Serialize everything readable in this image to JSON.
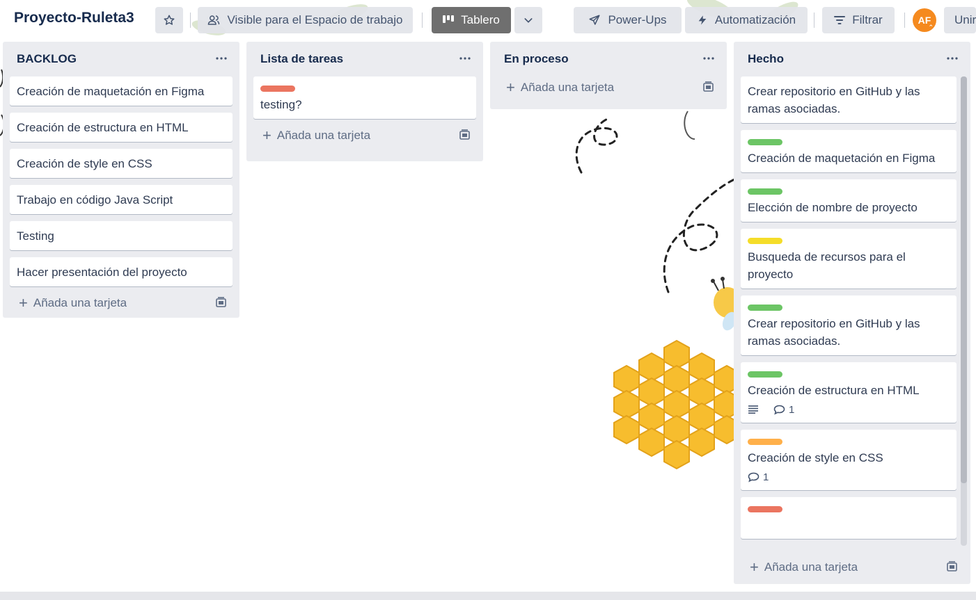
{
  "board": {
    "title": "Proyecto-Ruleta3",
    "visibility_label": "Visible para el Espacio de trabajo",
    "view_label": "Tablero",
    "powerups_label": "Power-Ups",
    "automation_label": "Automatización",
    "filter_label": "Filtrar",
    "avatar_initials": "AF",
    "join_label": "Unir"
  },
  "lists": [
    {
      "title": "BACKLOG",
      "cards": [
        {
          "title": "Creación de maquetación en Figma"
        },
        {
          "title": "Creación de estructura en HTML"
        },
        {
          "title": "Creación de style en CSS"
        },
        {
          "title": "Trabajo en código Java Script"
        },
        {
          "title": "Testing"
        },
        {
          "title": "Hacer presentación del proyecto"
        }
      ],
      "add_label": "Añada una tarjeta"
    },
    {
      "title": "Lista de tareas",
      "cards": [
        {
          "title": "testing?",
          "label_color": "#eb7560"
        }
      ],
      "add_label": "Añada una tarjeta"
    },
    {
      "title": "En proceso",
      "cards": [],
      "add_label": "Añada una tarjeta"
    },
    {
      "title": "Hecho",
      "cards": [
        {
          "title": "Crear repositorio en GitHub y las ramas asociadas."
        },
        {
          "title": "Creación de maquetación en Figma",
          "label_color": "#6cc565"
        },
        {
          "title": "Elección de nombre de proyecto",
          "label_color": "#6cc565"
        },
        {
          "title": "Busqueda de recursos para el proyecto",
          "label_color": "#f5dd29"
        },
        {
          "title": "Crear repositorio en GitHub y las ramas asociadas.",
          "label_color": "#6cc565"
        },
        {
          "title": "Creación de estructura en HTML",
          "label_color": "#6cc565",
          "comments": "1",
          "has_description": true
        },
        {
          "title": "Creación de style en CSS",
          "label_color": "#ffb04a",
          "comments": "1"
        },
        {
          "title": "",
          "label_color": "#eb7560"
        }
      ],
      "add_label": "Añada una tarjeta"
    }
  ],
  "icons": {
    "star": "star-icon",
    "visibility": "people-icon",
    "board": "board-icon",
    "chevron": "chevron-down-icon",
    "rocket": "rocket-icon",
    "bolt": "lightning-icon",
    "filter": "filter-icon",
    "more": "more-icon",
    "template": "template-icon",
    "description": "description-icon",
    "comment": "comment-icon"
  },
  "colors": {
    "list_bg": "#ebecf0",
    "active_view": "#6f6f6f",
    "avatar": "#f58a1f"
  }
}
